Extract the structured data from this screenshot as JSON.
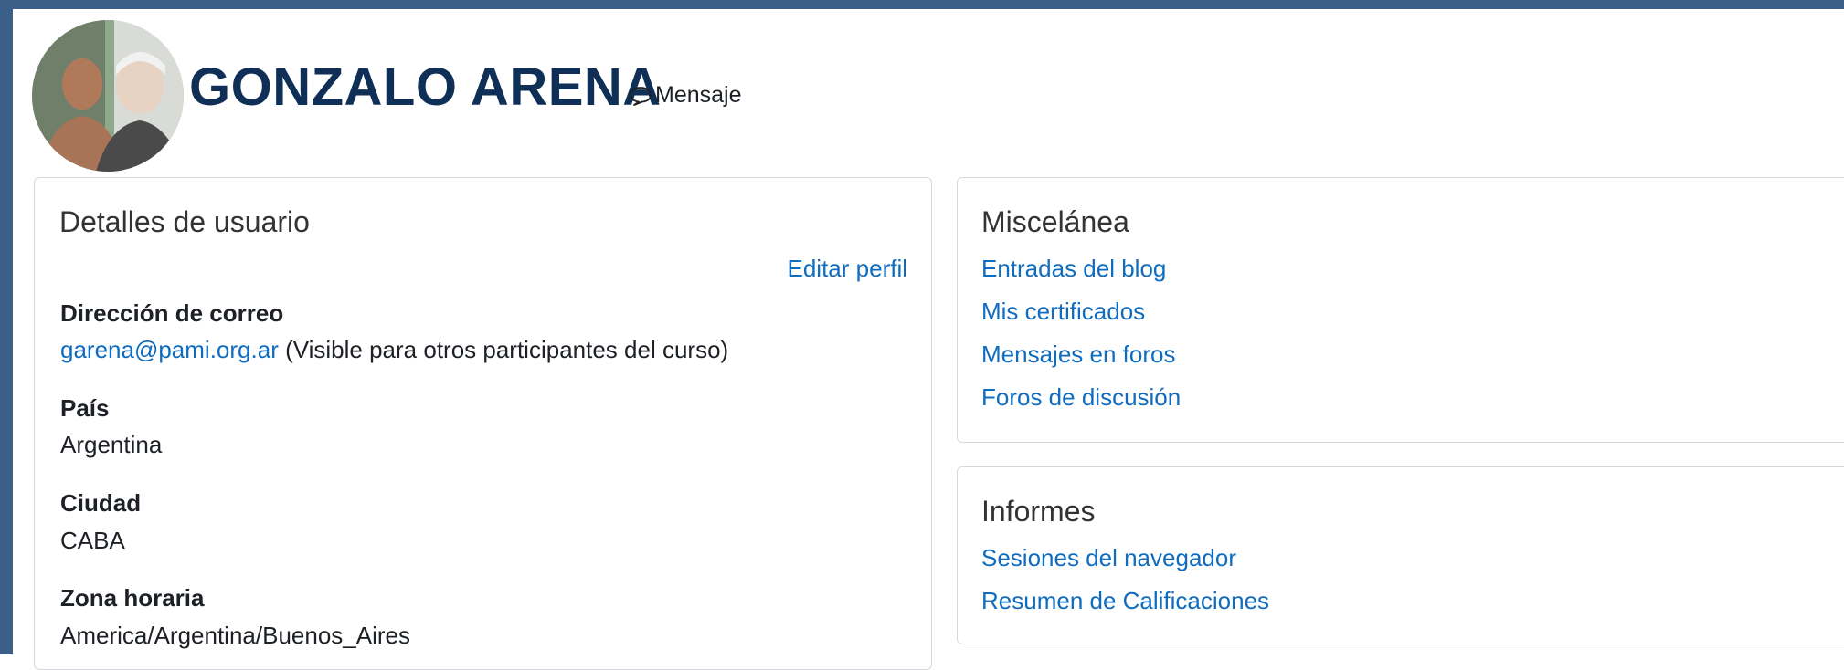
{
  "header": {
    "user_name": "GONZALO ARENA",
    "message_label": "Mensaje",
    "message_icon": "speech-bubble-icon"
  },
  "user_details": {
    "title": "Detalles de usuario",
    "edit_profile": "Editar perfil",
    "email_label": "Dirección de correo",
    "email_value": "garena@pami.org.ar",
    "email_visibility": "(Visible para otros participantes del curso)",
    "country_label": "País",
    "country_value": "Argentina",
    "city_label": "Ciudad",
    "city_value": "CABA",
    "timezone_label": "Zona horaria",
    "timezone_value": "America/Argentina/Buenos_Aires"
  },
  "misc": {
    "title": "Miscelánea",
    "links": [
      "Entradas del blog",
      "Mis certificados",
      "Mensajes en foros",
      "Foros de discusión"
    ]
  },
  "reports": {
    "title": "Informes",
    "links": [
      "Sesiones del navegador",
      "Resumen de Calificaciones"
    ]
  },
  "colors": {
    "frame": "#3b5f86",
    "name": "#0f2f57",
    "link": "#0f6cbf"
  }
}
